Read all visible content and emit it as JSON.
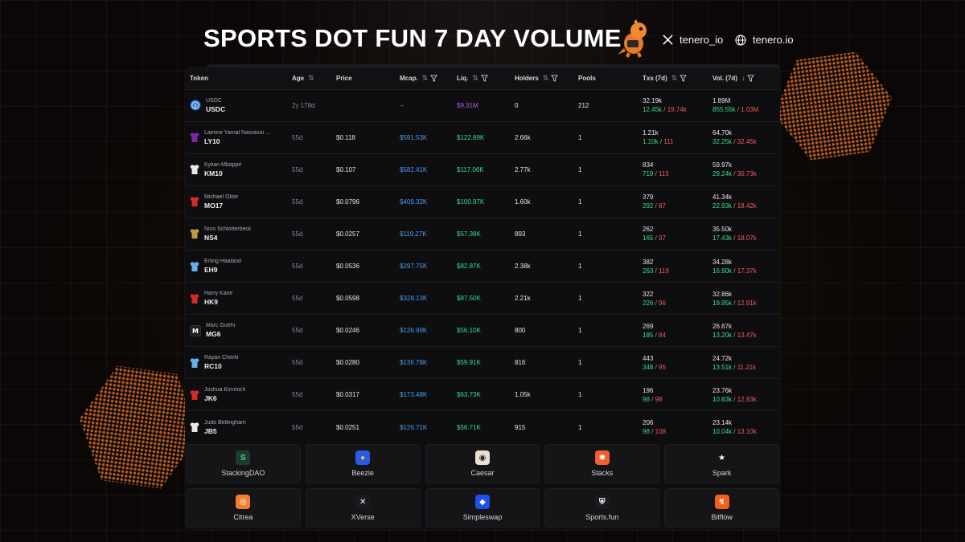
{
  "header": {
    "title": "SPORTS DOT FUN 7 DAY VOLUME",
    "social_x": "tenero_io",
    "social_web": "tenero.io"
  },
  "table": {
    "columns": {
      "token": "Token",
      "age": "Age",
      "price": "Price",
      "mcap": "Mcap.",
      "liq": "Liq.",
      "holders": "Holders",
      "pools": "Pools",
      "txs": "Txs (7d)",
      "vol": "Vol. (7d)"
    },
    "rows": [
      {
        "name": "USDC",
        "symbol": "USDC",
        "icon": "usdc-icon",
        "age": "2y 178d",
        "price": "",
        "mcap": "--",
        "liq": "$9.31M",
        "holders": "0",
        "pools": "212",
        "txs": "32.19k",
        "txs_buy": "12.45k",
        "txs_sell": "19.74k",
        "vol": "1.89M",
        "vol_buy": "855.55k",
        "vol_sell": "1.03M"
      },
      {
        "name": "Lamine Yamal Nasraoui ...",
        "symbol": "LY10",
        "icon": "jersey-icon",
        "jersey": "#7a2aa8",
        "age": "55d",
        "price": "$0.118",
        "mcap": "$591.53K",
        "liq": "$122.89K",
        "holders": "2.66k",
        "pools": "1",
        "txs": "1.21k",
        "txs_buy": "1.10k",
        "txs_sell": "111",
        "vol": "64.70k",
        "vol_buy": "32.25k",
        "vol_sell": "32.45k"
      },
      {
        "name": "Kylian Mbappé",
        "symbol": "KM10",
        "icon": "jersey-icon",
        "jersey": "#e8e8e8",
        "age": "55d",
        "price": "$0.107",
        "mcap": "$582.41K",
        "liq": "$117.06K",
        "holders": "2.77k",
        "pools": "1",
        "txs": "834",
        "txs_buy": "719",
        "txs_sell": "115",
        "vol": "59.97k",
        "vol_buy": "29.24k",
        "vol_sell": "30.73k"
      },
      {
        "name": "Michael Olise",
        "symbol": "MO17",
        "icon": "jersey-icon",
        "jersey": "#d42a2a",
        "age": "55d",
        "price": "$0.0796",
        "mcap": "$409.32K",
        "liq": "$100.97K",
        "holders": "1.60k",
        "pools": "1",
        "txs": "379",
        "txs_buy": "292",
        "txs_sell": "87",
        "vol": "41.34k",
        "vol_buy": "22.93k",
        "vol_sell": "18.42k"
      },
      {
        "name": "Nico Schlotterbeck",
        "symbol": "NS4",
        "icon": "jersey-icon",
        "jersey": "#b8a040",
        "age": "55d",
        "price": "$0.0257",
        "mcap": "$119.27K",
        "liq": "$57.38K",
        "holders": "893",
        "pools": "1",
        "txs": "262",
        "txs_buy": "165",
        "txs_sell": "97",
        "vol": "35.50k",
        "vol_buy": "17.43k",
        "vol_sell": "18.07k"
      },
      {
        "name": "Erling Haaland",
        "symbol": "EH9",
        "icon": "jersey-icon",
        "jersey": "#6ab0e8",
        "age": "55d",
        "price": "$0.0536",
        "mcap": "$297.75K",
        "liq": "$82.87K",
        "holders": "2.38k",
        "pools": "1",
        "txs": "382",
        "txs_buy": "263",
        "txs_sell": "119",
        "vol": "34.28k",
        "vol_buy": "16.90k",
        "vol_sell": "17.37k"
      },
      {
        "name": "Harry Kane",
        "symbol": "HK9",
        "icon": "jersey-icon",
        "jersey": "#d42a2a",
        "age": "55d",
        "price": "$0.0598",
        "mcap": "$328.13K",
        "liq": "$87.50K",
        "holders": "2.21k",
        "pools": "1",
        "txs": "322",
        "txs_buy": "226",
        "txs_sell": "96",
        "vol": "32.86k",
        "vol_buy": "19.95k",
        "vol_sell": "12.91k"
      },
      {
        "name": "Marc Guéhi",
        "symbol": "MG6",
        "icon": "letter-m-icon",
        "age": "55d",
        "price": "$0.0246",
        "mcap": "$126.99K",
        "liq": "$56.10K",
        "holders": "800",
        "pools": "1",
        "txs": "269",
        "txs_buy": "185",
        "txs_sell": "84",
        "vol": "26.67k",
        "vol_buy": "13.20k",
        "vol_sell": "13.47k"
      },
      {
        "name": "Rayan Cherki",
        "symbol": "RC10",
        "icon": "jersey-icon",
        "jersey": "#6ab0e8",
        "age": "55d",
        "price": "$0.0280",
        "mcap": "$136.78K",
        "liq": "$59.91K",
        "holders": "816",
        "pools": "1",
        "txs": "443",
        "txs_buy": "348",
        "txs_sell": "95",
        "vol": "24.72k",
        "vol_buy": "13.51k",
        "vol_sell": "11.21k"
      },
      {
        "name": "Joshua Kimmich",
        "symbol": "JK6",
        "icon": "jersey-icon",
        "jersey": "#d42a2a",
        "age": "55d",
        "price": "$0.0317",
        "mcap": "$173.48K",
        "liq": "$63.73K",
        "holders": "1.05k",
        "pools": "1",
        "txs": "196",
        "txs_buy": "98",
        "txs_sell": "98",
        "vol": "23.76k",
        "vol_buy": "10.83k",
        "vol_sell": "12.93k"
      },
      {
        "name": "Jude Bellingham",
        "symbol": "JB5",
        "icon": "jersey-icon",
        "jersey": "#e8e8e8",
        "age": "55d",
        "price": "$0.0251",
        "mcap": "$126.71K",
        "liq": "$56.71K",
        "holders": "915",
        "pools": "1",
        "txs": "206",
        "txs_buy": "98",
        "txs_sell": "108",
        "vol": "23.14k",
        "vol_buy": "10.04k",
        "vol_sell": "13.10k"
      }
    ]
  },
  "partners": [
    {
      "name": "StackingDAO",
      "logo_bg": "#1d3b2f",
      "logo_fg": "#3ddc84",
      "glyph": "S"
    },
    {
      "name": "Beezie",
      "logo_bg": "#2a5ae8",
      "logo_fg": "#f0c020",
      "glyph": "●"
    },
    {
      "name": "Caesar",
      "logo_bg": "#e8e0d0",
      "logo_fg": "#222222",
      "glyph": "◉"
    },
    {
      "name": "Stacks",
      "logo_bg": "#f06030",
      "logo_fg": "#ffffff",
      "glyph": "✱"
    },
    {
      "name": "Spark",
      "logo_bg": "#151518",
      "logo_fg": "#ffffff",
      "glyph": "★"
    },
    {
      "name": "Citrea",
      "logo_bg": "#f08030",
      "logo_fg": "#ffffff",
      "glyph": "◎"
    },
    {
      "name": "XVerse",
      "logo_bg": "#1a1a1e",
      "logo_fg": "#ffffff",
      "glyph": "✕"
    },
    {
      "name": "Simpleswap",
      "logo_bg": "#2050e8",
      "logo_fg": "#ffffff",
      "glyph": "◆"
    },
    {
      "name": "Sports.fun",
      "logo_bg": "#1a1a1e",
      "logo_fg": "#ffffff",
      "glyph": "⛨"
    },
    {
      "name": "Bitflow",
      "logo_bg": "#f06020",
      "logo_fg": "#ffffff",
      "glyph": "↯"
    }
  ]
}
